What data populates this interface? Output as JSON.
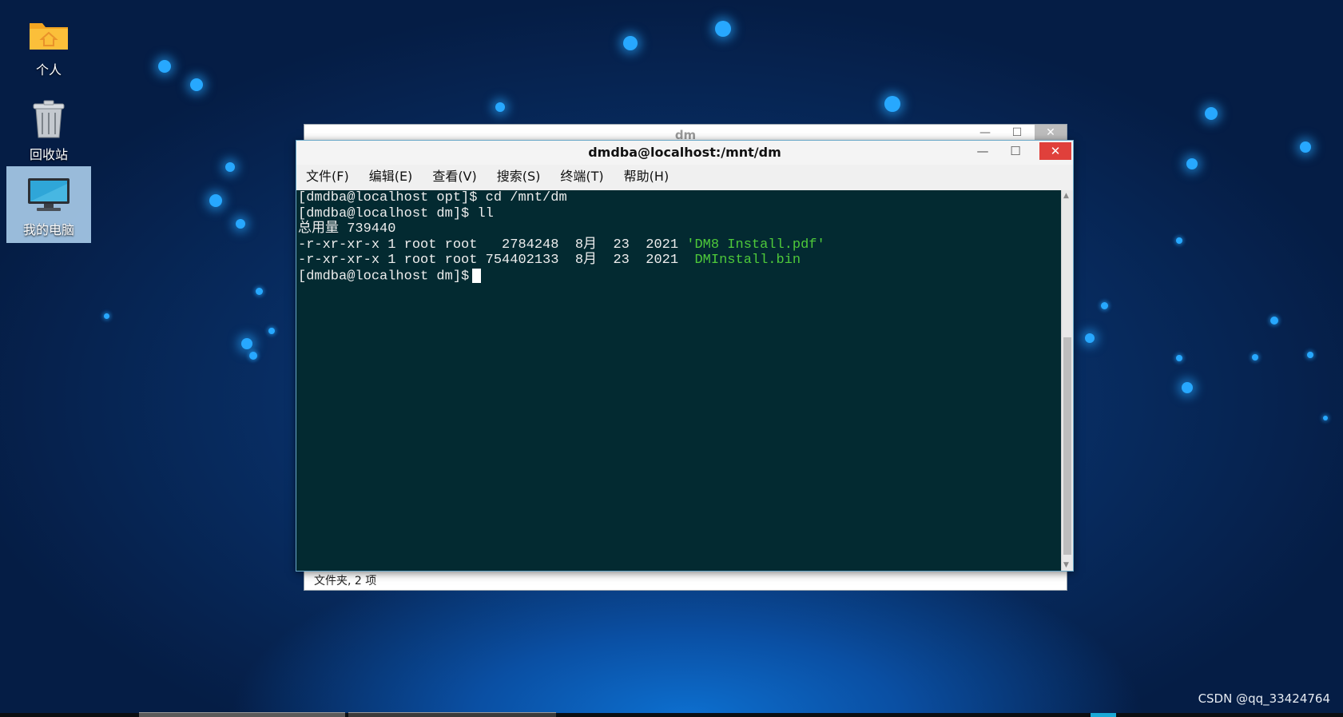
{
  "desktop": {
    "icons": [
      {
        "label": "个人",
        "icon": "home-folder-icon"
      },
      {
        "label": "回收站",
        "icon": "trash-icon"
      },
      {
        "label": "我的电脑",
        "icon": "computer-icon"
      }
    ],
    "watermark": "CSDN @qq_33424764"
  },
  "file_manager": {
    "title": "dm",
    "status": "文件夹, 2 项",
    "buttons": {
      "minimize": "—",
      "maximize": "☐",
      "close": "✕"
    }
  },
  "terminal_window": {
    "title": "dmdba@localhost:/mnt/dm",
    "buttons": {
      "minimize": "—",
      "maximize": "☐",
      "close": "✕"
    },
    "menu": [
      "文件(F)",
      "编辑(E)",
      "查看(V)",
      "搜索(S)",
      "终端(T)",
      "帮助(H)"
    ],
    "lines": [
      {
        "text": "[dmdba@localhost opt]$ cd /mnt/dm",
        "highlight": ""
      },
      {
        "text": "[dmdba@localhost dm]$ ll",
        "highlight": ""
      },
      {
        "text": "总用量 739440",
        "highlight": ""
      },
      {
        "text": "-r-xr-xr-x 1 root root   2784248  8月  23  2021 ",
        "highlight": "'DM8 Install.pdf'"
      },
      {
        "text": "-r-xr-xr-x 1 root root 754402133  8月  23  2021  ",
        "highlight": "DMInstall.bin"
      },
      {
        "text": "[dmdba@localhost dm]$",
        "highlight": ""
      }
    ],
    "colors": {
      "background": "#032a31",
      "text": "#ededed",
      "file_highlight": "#4ec93a"
    }
  }
}
